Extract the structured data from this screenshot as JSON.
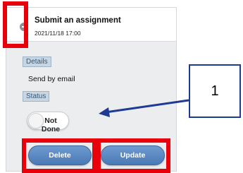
{
  "card": {
    "title": "Submit an assignment",
    "date": "2021/11/18 17:00",
    "details_label": "Details",
    "details_text": "Send by email",
    "status_label": "Status",
    "status_toggle": "Not Done",
    "delete_label": "Delete",
    "update_label": "Update",
    "collapse_icon": "minus-circle-icon"
  },
  "annotation": {
    "callout_number": "1",
    "highlight_color": "#e8000b",
    "arrow_color": "#1f3a93"
  },
  "colors": {
    "button_accent": "#4a79b4",
    "card_background": "#ecedef"
  }
}
